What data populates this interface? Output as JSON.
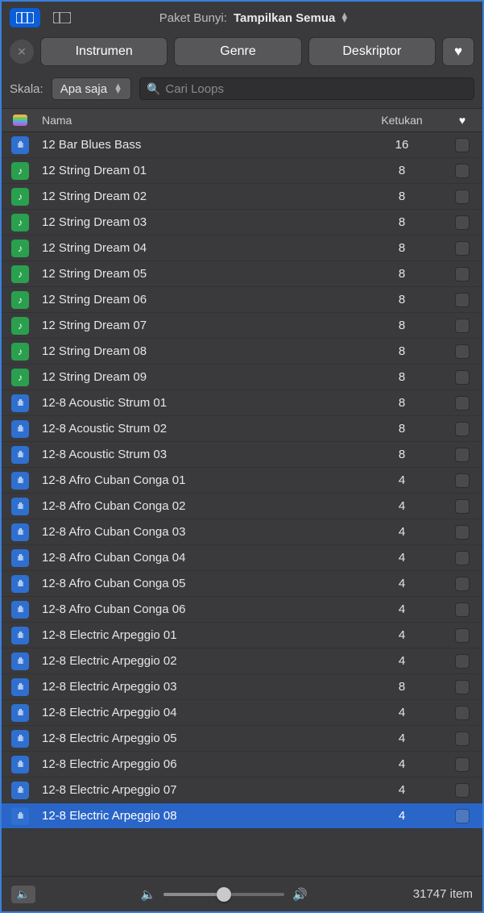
{
  "header": {
    "pack_label": "Paket Bunyi:",
    "pack_value": "Tampilkan Semua"
  },
  "filters": {
    "instruments": "Instrumen",
    "genre": "Genre",
    "descriptor": "Deskriptor"
  },
  "scale": {
    "label": "Skala:",
    "value": "Apa saja"
  },
  "search": {
    "placeholder": "Cari Loops"
  },
  "columns": {
    "name": "Nama",
    "beats": "Ketukan"
  },
  "rows": [
    {
      "type": "audio",
      "name": "12 Bar Blues Bass",
      "beats": "16",
      "selected": false
    },
    {
      "type": "midi",
      "name": "12 String Dream 01",
      "beats": "8",
      "selected": false
    },
    {
      "type": "midi",
      "name": "12 String Dream 02",
      "beats": "8",
      "selected": false
    },
    {
      "type": "midi",
      "name": "12 String Dream 03",
      "beats": "8",
      "selected": false
    },
    {
      "type": "midi",
      "name": "12 String Dream 04",
      "beats": "8",
      "selected": false
    },
    {
      "type": "midi",
      "name": "12 String Dream 05",
      "beats": "8",
      "selected": false
    },
    {
      "type": "midi",
      "name": "12 String Dream 06",
      "beats": "8",
      "selected": false
    },
    {
      "type": "midi",
      "name": "12 String Dream 07",
      "beats": "8",
      "selected": false
    },
    {
      "type": "midi",
      "name": "12 String Dream 08",
      "beats": "8",
      "selected": false
    },
    {
      "type": "midi",
      "name": "12 String Dream 09",
      "beats": "8",
      "selected": false
    },
    {
      "type": "audio",
      "name": "12-8 Acoustic Strum 01",
      "beats": "8",
      "selected": false
    },
    {
      "type": "audio",
      "name": "12-8 Acoustic Strum 02",
      "beats": "8",
      "selected": false
    },
    {
      "type": "audio",
      "name": "12-8 Acoustic Strum 03",
      "beats": "8",
      "selected": false
    },
    {
      "type": "audio",
      "name": "12-8 Afro Cuban Conga 01",
      "beats": "4",
      "selected": false
    },
    {
      "type": "audio",
      "name": "12-8 Afro Cuban Conga 02",
      "beats": "4",
      "selected": false
    },
    {
      "type": "audio",
      "name": "12-8 Afro Cuban Conga 03",
      "beats": "4",
      "selected": false
    },
    {
      "type": "audio",
      "name": "12-8 Afro Cuban Conga 04",
      "beats": "4",
      "selected": false
    },
    {
      "type": "audio",
      "name": "12-8 Afro Cuban Conga 05",
      "beats": "4",
      "selected": false
    },
    {
      "type": "audio",
      "name": "12-8 Afro Cuban Conga 06",
      "beats": "4",
      "selected": false
    },
    {
      "type": "audio",
      "name": "12-8 Electric Arpeggio 01",
      "beats": "4",
      "selected": false
    },
    {
      "type": "audio",
      "name": "12-8 Electric Arpeggio 02",
      "beats": "4",
      "selected": false
    },
    {
      "type": "audio",
      "name": "12-8 Electric Arpeggio 03",
      "beats": "8",
      "selected": false
    },
    {
      "type": "audio",
      "name": "12-8 Electric Arpeggio 04",
      "beats": "4",
      "selected": false
    },
    {
      "type": "audio",
      "name": "12-8 Electric Arpeggio 05",
      "beats": "4",
      "selected": false
    },
    {
      "type": "audio",
      "name": "12-8 Electric Arpeggio 06",
      "beats": "4",
      "selected": false
    },
    {
      "type": "audio",
      "name": "12-8 Electric Arpeggio 07",
      "beats": "4",
      "selected": false
    },
    {
      "type": "audio",
      "name": "12-8 Electric Arpeggio 08",
      "beats": "4",
      "selected": true
    }
  ],
  "footer": {
    "item_count": "31747 item"
  }
}
